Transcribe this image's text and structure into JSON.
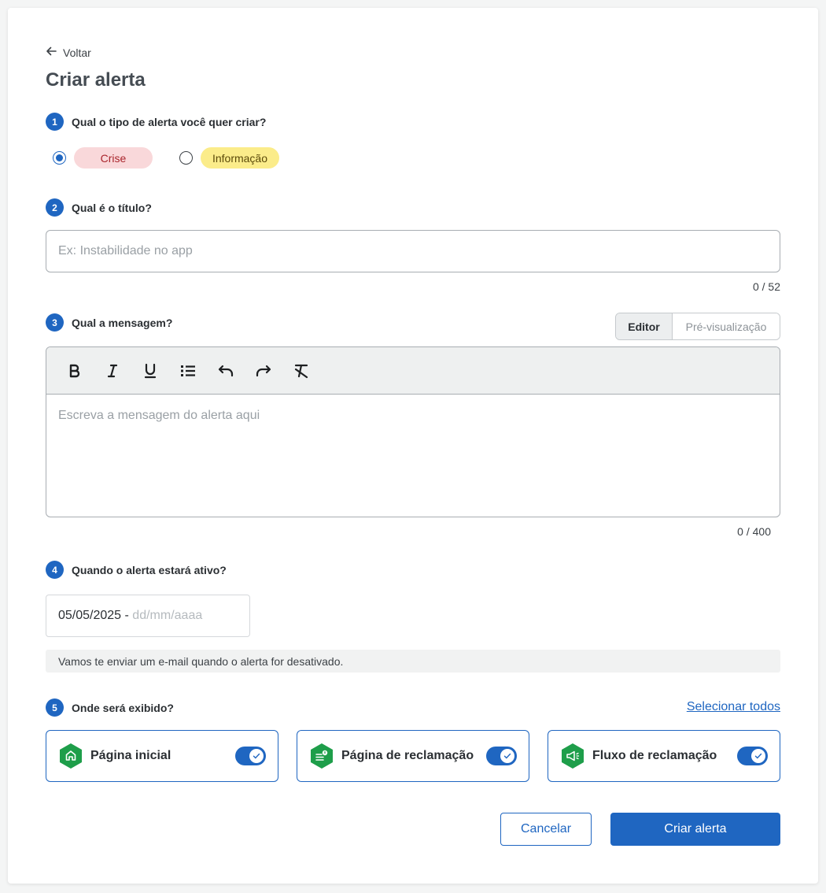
{
  "header": {
    "back_label": "Voltar",
    "title": "Criar alerta"
  },
  "step1": {
    "number": "1",
    "question": "Qual o tipo de alerta você quer criar?",
    "options": [
      {
        "label": "Crise",
        "selected": true,
        "color": "#f9d8da"
      },
      {
        "label": "Informação",
        "selected": false,
        "color": "#fbec8a"
      }
    ]
  },
  "step2": {
    "number": "2",
    "question": "Qual é o título?",
    "placeholder": "Ex: Instabilidade no app",
    "counter": "0 / 52"
  },
  "step3": {
    "number": "3",
    "question": "Qual a mensagem?",
    "tabs": {
      "editor": "Editor",
      "preview": "Pré-visualização"
    },
    "toolbar": [
      "bold-icon",
      "italic-icon",
      "underline-icon",
      "bullet-list-icon",
      "undo-icon",
      "redo-icon",
      "clear-format-icon"
    ],
    "placeholder": "Escreva a mensagem do alerta aqui",
    "counter": "0 / 400"
  },
  "step4": {
    "number": "4",
    "question": "Quando o alerta estará ativo?",
    "date_value": "05/05/2025 - ",
    "date_placeholder": "dd/mm/aaaa",
    "notice": "Vamos te enviar um e-mail quando o alerta for desativado."
  },
  "step5": {
    "number": "5",
    "question": "Onde será exibido?",
    "select_all": "Selecionar todos",
    "locations": [
      {
        "label": "Página inicial",
        "icon": "home-icon",
        "enabled": true
      },
      {
        "label": "Página de reclamação",
        "icon": "complaint-page-icon",
        "enabled": true
      },
      {
        "label": "Fluxo de reclamação",
        "icon": "megaphone-icon",
        "enabled": true
      }
    ]
  },
  "footer": {
    "cancel_label": "Cancelar",
    "create_label": "Criar alerta"
  },
  "colors": {
    "primary": "#1f66c1",
    "success_green": "#1e9e4a",
    "crise_text": "#a9252c"
  }
}
